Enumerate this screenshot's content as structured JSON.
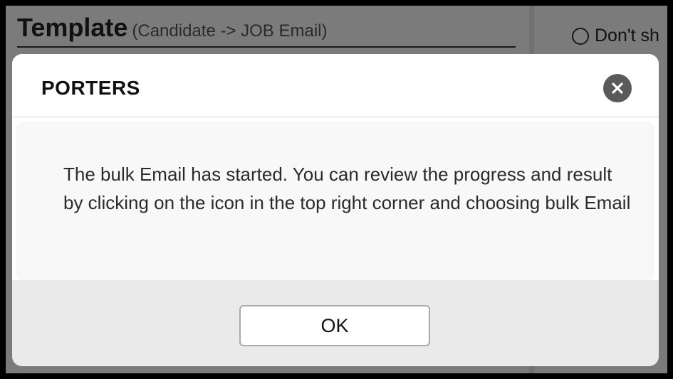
{
  "background": {
    "template_title": "Template",
    "template_subtitle": "(Candidate -> JOB Email)",
    "radio_label": "Don't sh"
  },
  "modal": {
    "title": "PORTERS",
    "close_icon": "close-icon",
    "message": "The bulk Email has started. You can review the progress and result by clicking on the icon in the top right corner and choosing bulk Email",
    "ok_label": "OK"
  },
  "colors": {
    "overlay": "#000000",
    "close_button_bg": "#5a5a5a",
    "footer_bg": "#eaeaea",
    "body_bg": "#f8f8f8",
    "accent_blue": "#2f5bb0"
  }
}
